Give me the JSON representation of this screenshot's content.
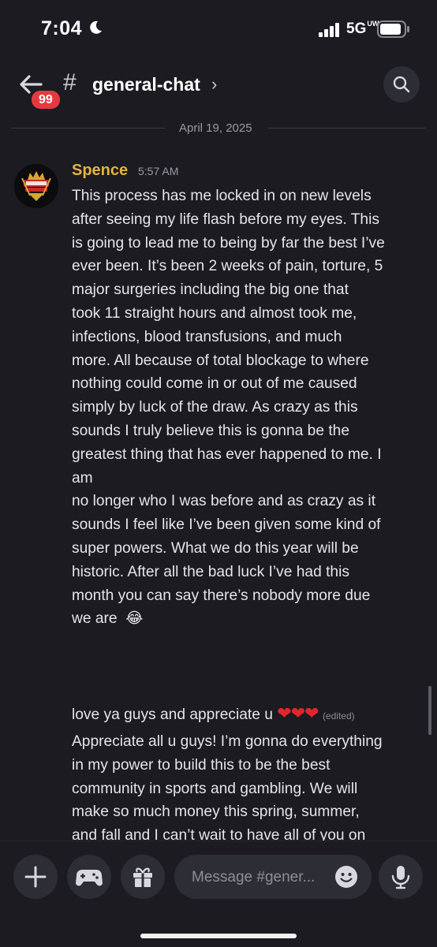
{
  "status_bar": {
    "time": "7:04",
    "network": "5G",
    "network_sub": "UW"
  },
  "header": {
    "unread_badge": "99",
    "hash": "#",
    "channel": "general-chat",
    "chevron": "›"
  },
  "date_divider": "April 19, 2025",
  "message": {
    "author": "Spence",
    "timestamp": "5:57 AM",
    "lines": [
      "This process has me locked in on new levels",
      "after seeing my life flash before my eyes. This",
      "is going to lead me to being by far the best I’ve",
      "ever been. It’s been 2 weeks of pain, torture, 5",
      "major surgeries including the big one that",
      "took 11 straight hours and almost took me,",
      "infections, blood transfusions, and much",
      "more. All because of total blockage to where",
      "nothing could come in or out of me caused",
      "simply by luck of the draw. As crazy as this",
      "sounds I truly believe this is gonna be the",
      "greatest thing that has ever happened to me. I",
      "am",
      "no longer who I was before and as crazy as it",
      "sounds I feel like I’ve been given some kind of",
      "super powers. What we do this year will be",
      "historic. After all the bad luck I’ve had this",
      "month you can say there’s nobody more due",
      "we are"
    ],
    "laugh_emoji": "😂"
  },
  "message2": {
    "text": "love ya guys and appreciate u",
    "hearts": "❤❤❤",
    "edited": "(edited)"
  },
  "message3": {
    "lines": [
      "Appreciate all u guys! I’m gonna do everything",
      "in my power to build this to be the best",
      "community in sports and gambling. We will",
      "make so much money this spring, summer,",
      "and fall and I can’t wait to have all of you on"
    ]
  },
  "composer": {
    "placeholder": "Message #gener..."
  },
  "icons": [
    "moon-icon",
    "signal-icon",
    "battery-icon",
    "back-arrow-icon",
    "search-icon",
    "plus-icon",
    "gamepad-icon",
    "gift-icon",
    "emoji-icon",
    "microphone-icon"
  ]
}
